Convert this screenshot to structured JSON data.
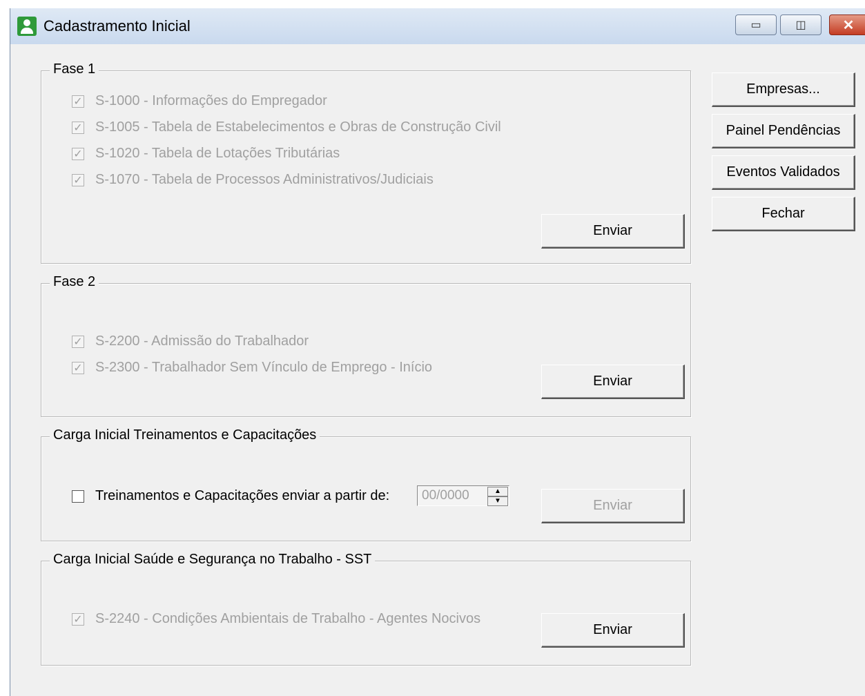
{
  "window": {
    "title": "Cadastramento Inicial"
  },
  "titlebar_icons": {
    "app": "person-icon",
    "min": "minimize-icon",
    "max": "maximize-icon",
    "close": "close-icon"
  },
  "fase1": {
    "legend": "Fase 1",
    "items": [
      {
        "label": "S-1000 - Informações do Empregador",
        "checked": true,
        "enabled": false
      },
      {
        "label": "S-1005 - Tabela de Estabelecimentos e Obras de Construção Civil",
        "checked": true,
        "enabled": false
      },
      {
        "label": "S-1020 - Tabela de Lotações Tributárias",
        "checked": true,
        "enabled": false
      },
      {
        "label": "S-1070 - Tabela de Processos Administrativos/Judiciais",
        "checked": true,
        "enabled": false
      }
    ],
    "send_label": "Enviar"
  },
  "fase2": {
    "legend": "Fase 2",
    "items": [
      {
        "label": "S-2200 - Admissão do Trabalhador",
        "checked": true,
        "enabled": false
      },
      {
        "label": "S-2300 - Trabalhador Sem Vínculo de Emprego - Início",
        "checked": true,
        "enabled": false
      }
    ],
    "send_label": "Enviar"
  },
  "treinamentos": {
    "legend": "Carga Inicial Treinamentos e Capacitações",
    "checkbox_label": "Treinamentos e Capacitações enviar a partir de:",
    "checked": false,
    "date_value": "00/0000",
    "send_label": "Enviar",
    "send_enabled": false
  },
  "sst": {
    "legend": "Carga Inicial Saúde e Segurança no Trabalho - SST",
    "items": [
      {
        "label": "S-2240 - Condições Ambientais de Trabalho - Agentes Nocivos",
        "checked": true,
        "enabled": false
      }
    ],
    "send_label": "Enviar"
  },
  "side_buttons": {
    "empresas": "Empresas...",
    "painel": "Painel Pendências",
    "eventos": "Eventos Validados",
    "fechar": "Fechar"
  },
  "colors": {
    "window_bg": "#f0f0f0",
    "disabled_text": "#a0a0a0",
    "titlebar": "#c9d9ee"
  }
}
